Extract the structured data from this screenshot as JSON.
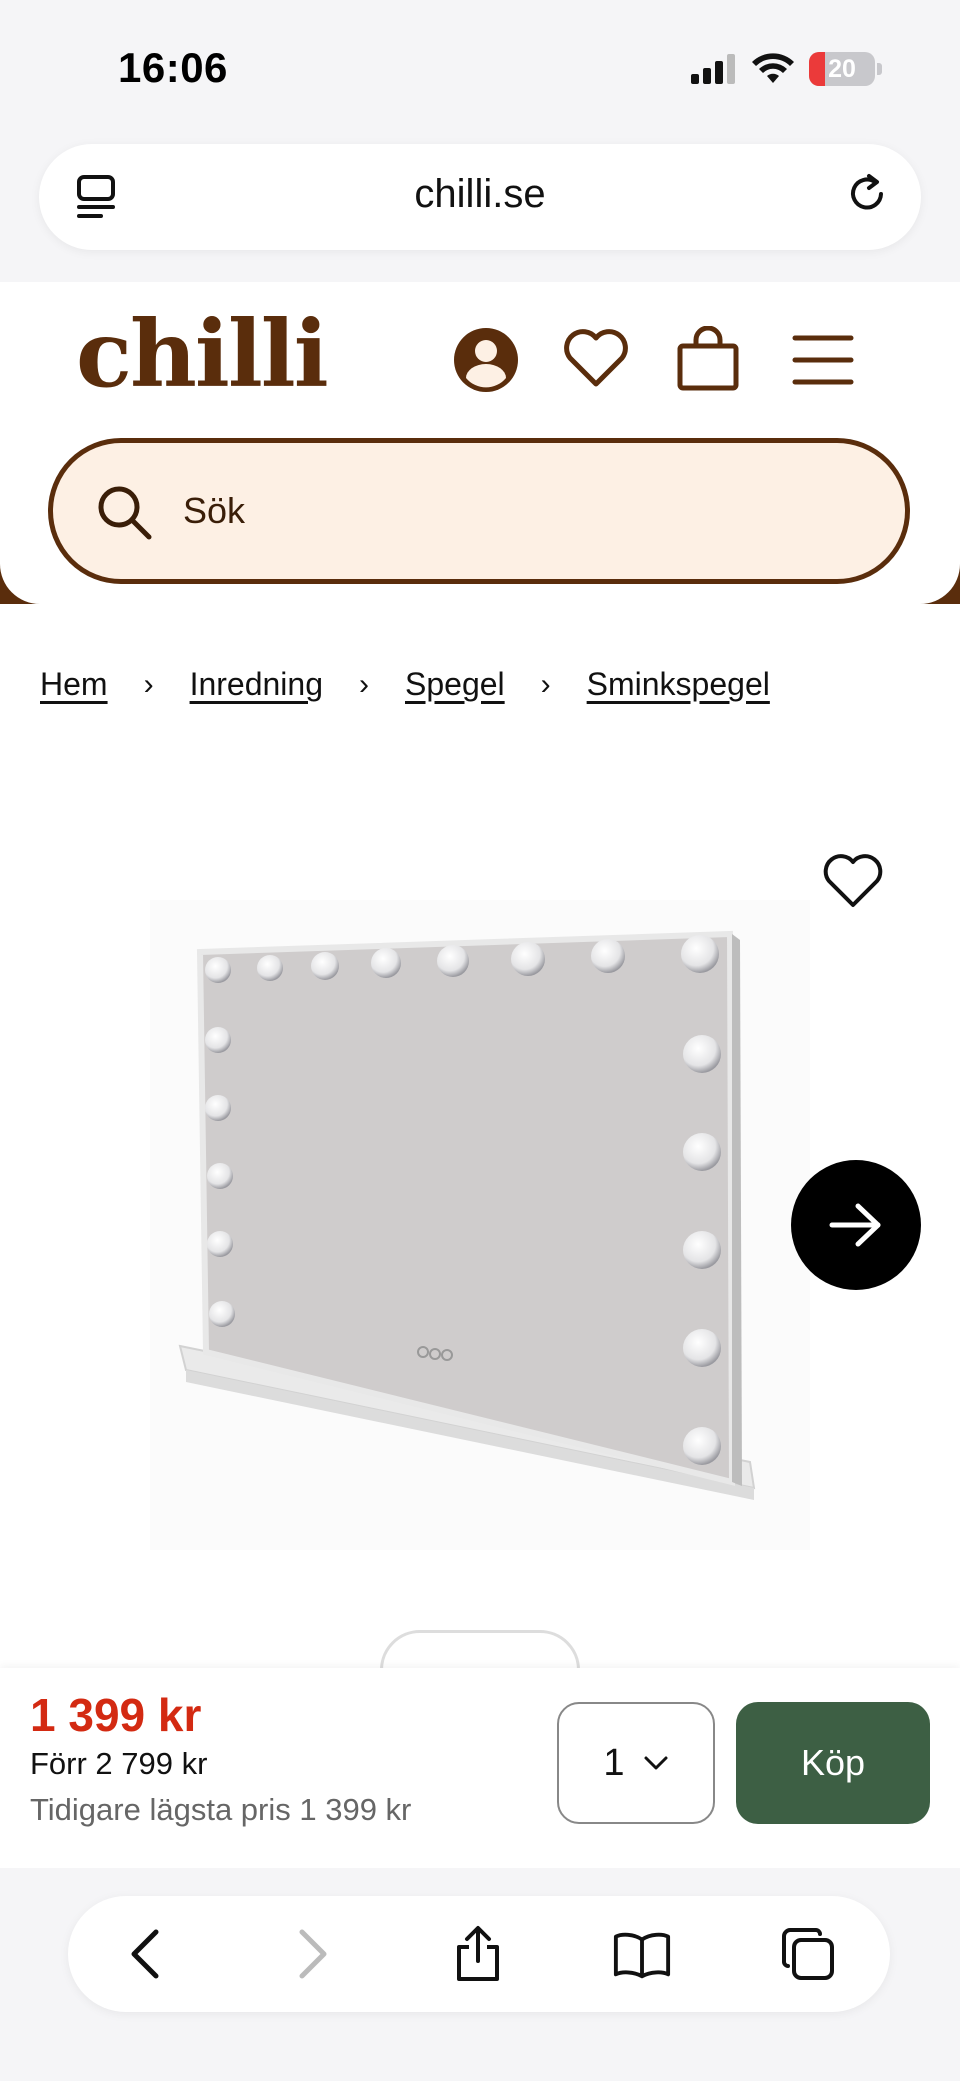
{
  "status_bar": {
    "time": "16:06",
    "battery": "20"
  },
  "browser": {
    "url": "chilli.se"
  },
  "site": {
    "logo": "chilli"
  },
  "search": {
    "placeholder": "Sök"
  },
  "breadcrumb": [
    "Hem",
    "Inredning",
    "Spegel",
    "Sminkspegel"
  ],
  "breadcrumb_sep": "›",
  "product": {
    "price": "1 399 kr",
    "was_price": "Förr 2 799 kr",
    "lowest_price": "Tidigare lägsta pris 1 399 kr",
    "quantity": "1",
    "buy_label": "Köp"
  },
  "colors": {
    "brand": "#5a2d0c",
    "search_bg": "#fdf0e4",
    "price": "#d32a12",
    "buy_button": "#3d5f44"
  }
}
